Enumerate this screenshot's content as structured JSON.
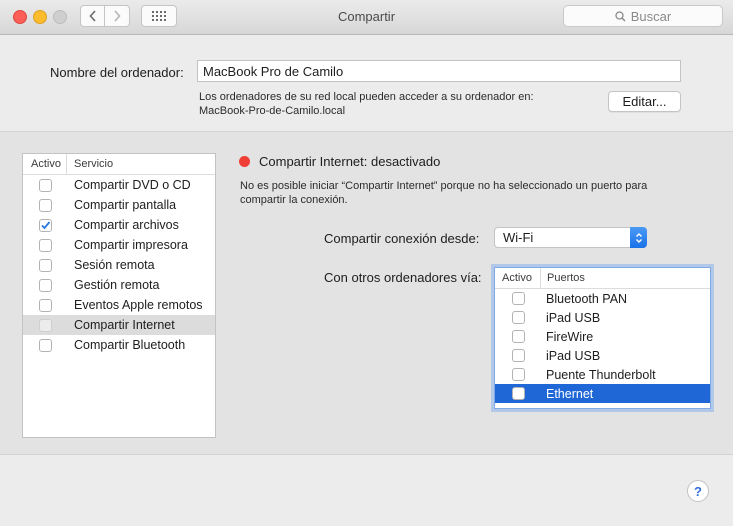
{
  "window": {
    "title": "Compartir",
    "search_placeholder": "Buscar"
  },
  "computer": {
    "name_label": "Nombre del ordenador:",
    "name_value": "MacBook Pro de Camilo",
    "info_line1": "Los ordenadores de su red local pueden acceder a su ordenador en:",
    "info_line2": "MacBook-Pro-de-Camilo.local",
    "edit_button": "Editar..."
  },
  "services": {
    "header_active": "Activo",
    "header_service": "Servicio",
    "items": [
      {
        "label": "Compartir DVD o CD",
        "checked": false
      },
      {
        "label": "Compartir pantalla",
        "checked": false
      },
      {
        "label": "Compartir archivos",
        "checked": true
      },
      {
        "label": "Compartir impresora",
        "checked": false
      },
      {
        "label": "Sesión remota",
        "checked": false
      },
      {
        "label": "Gestión remota",
        "checked": false
      },
      {
        "label": "Eventos Apple remotos",
        "checked": false
      },
      {
        "label": "Compartir Internet",
        "checked": false,
        "selected": true
      },
      {
        "label": "Compartir Bluetooth",
        "checked": false
      }
    ]
  },
  "internet_sharing": {
    "status": "Compartir Internet: desactivado",
    "status_color": "#ef3e36",
    "description_line1": "No es posible iniciar “Compartir Internet” porque no ha seleccionado un puerto para",
    "description_line2": "compartir la conexión.",
    "from_label": "Compartir conexión desde:",
    "from_value": "Wi-Fi",
    "via_label": "Con otros ordenadores vía:",
    "ports_header_active": "Activo",
    "ports_header_ports": "Puertos",
    "ports": [
      {
        "label": "Bluetooth PAN",
        "checked": false
      },
      {
        "label": "iPad USB",
        "checked": false
      },
      {
        "label": "FireWire",
        "checked": false
      },
      {
        "label": "iPad USB",
        "checked": false
      },
      {
        "label": "Puente Thunderbolt",
        "checked": false
      },
      {
        "label": "Ethernet",
        "checked": false,
        "selected": true
      }
    ]
  },
  "help": {
    "label": "?"
  },
  "icons": {
    "back": "chevron-left-icon",
    "forward": "chevron-right-icon",
    "grid": "grid-icon",
    "search": "search-icon",
    "checkmark": "checkmark-icon",
    "popup_arrows": "updown-arrows-icon"
  },
  "colors": {
    "accent": "#1f67d6",
    "checkmark": "#2a7ae2"
  }
}
